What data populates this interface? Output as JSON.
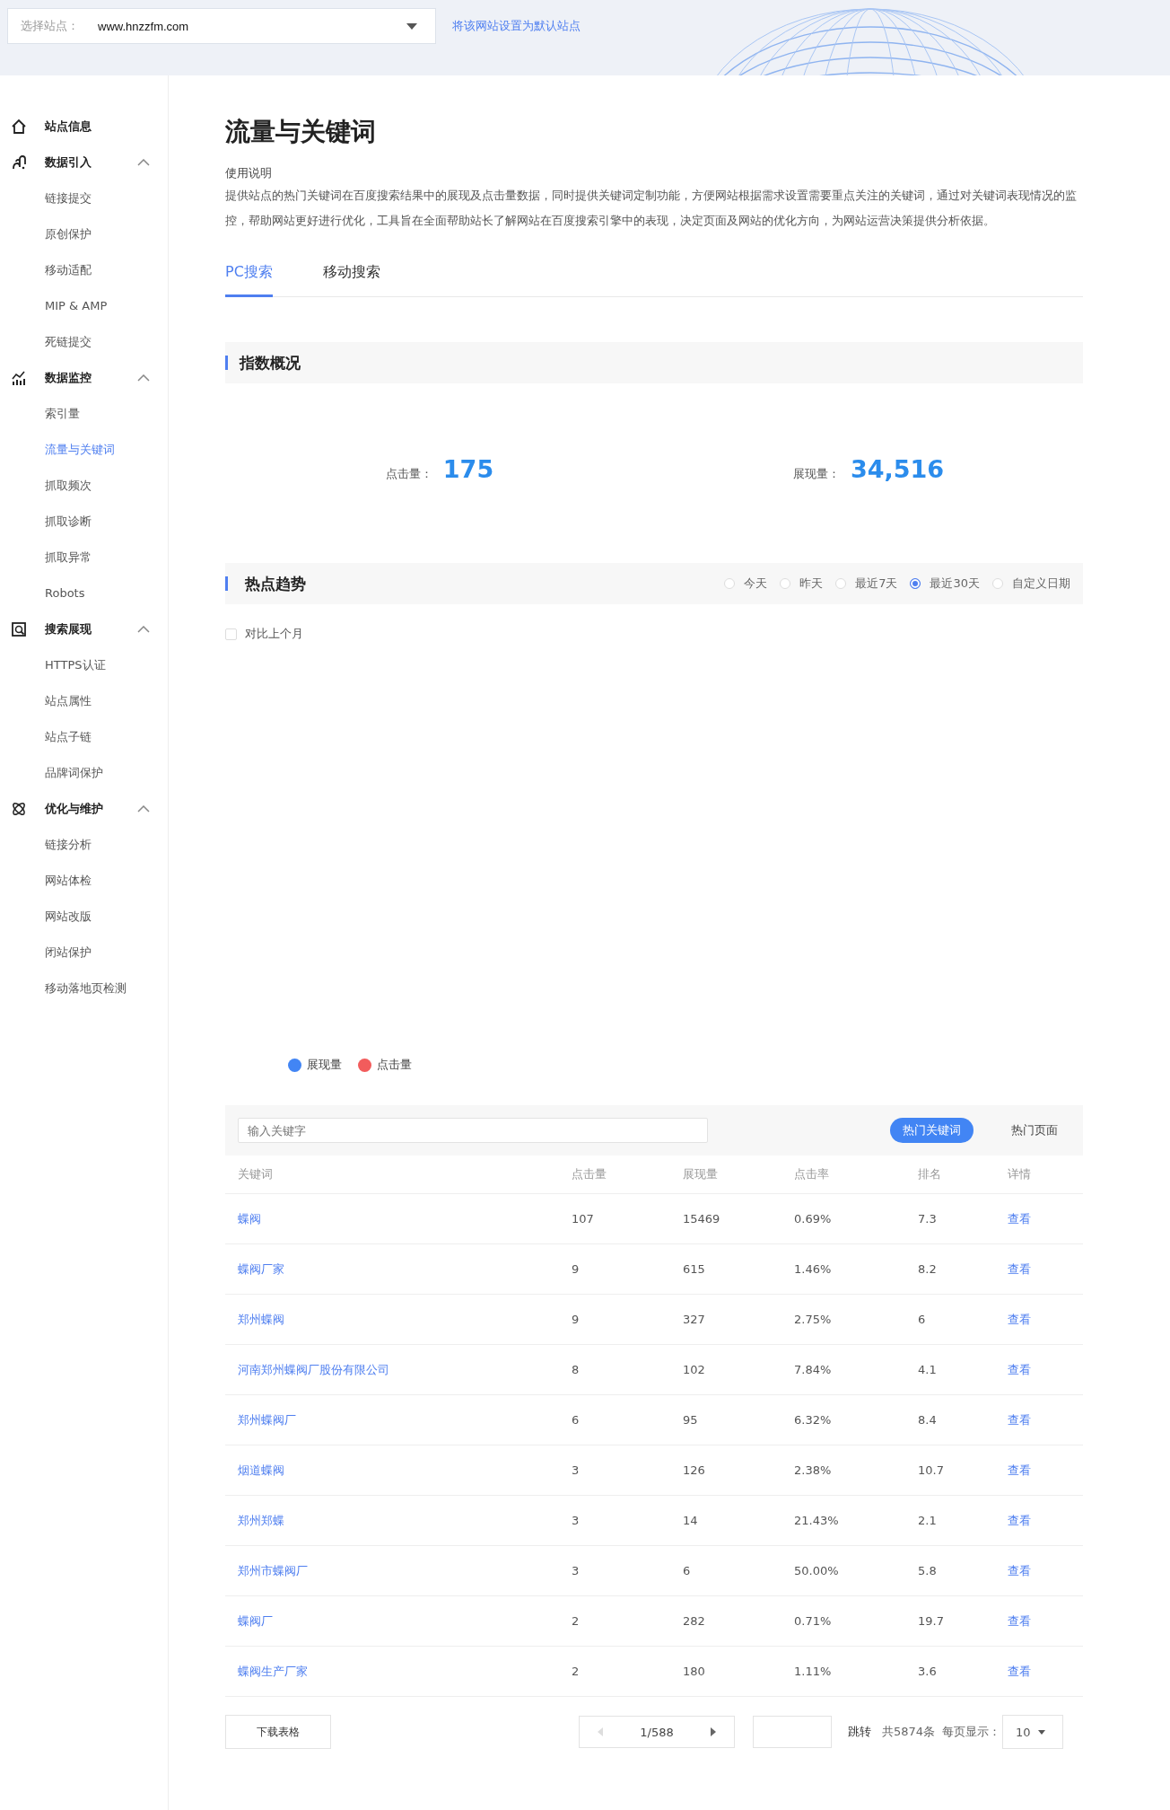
{
  "site_selector": {
    "label": "选择站点：",
    "value": "www.hnzzfm.com"
  },
  "set_default_link": "将该网站设置为默认站点",
  "sidebar": [
    {
      "kind": "link",
      "label": "站点信息"
    },
    {
      "kind": "group",
      "label": "数据引入",
      "expanded": true,
      "children": [
        {
          "label": "链接提交",
          "selected": false
        },
        {
          "label": "原创保护",
          "selected": false
        },
        {
          "label": "移动适配",
          "selected": false
        },
        {
          "label": "MIP & AMP",
          "selected": false
        },
        {
          "label": "死链提交",
          "selected": false
        }
      ]
    },
    {
      "kind": "group",
      "label": "数据监控",
      "expanded": true,
      "children": [
        {
          "label": "索引量",
          "selected": false
        },
        {
          "label": "流量与关键词",
          "selected": true
        },
        {
          "label": "抓取频次",
          "selected": false
        },
        {
          "label": "抓取诊断",
          "selected": false
        },
        {
          "label": "抓取异常",
          "selected": false
        },
        {
          "label": "Robots",
          "selected": false
        }
      ]
    },
    {
      "kind": "group",
      "label": "搜索展现",
      "expanded": true,
      "children": [
        {
          "label": "HTTPS认证",
          "selected": false
        },
        {
          "label": "站点属性",
          "selected": false
        },
        {
          "label": "站点子链",
          "selected": false
        },
        {
          "label": "品牌词保护",
          "selected": false
        }
      ]
    },
    {
      "kind": "group",
      "label": "优化与维护",
      "expanded": true,
      "children": [
        {
          "label": "链接分析",
          "selected": false
        },
        {
          "label": "网站体检",
          "selected": false
        },
        {
          "label": "网站改版",
          "selected": false
        },
        {
          "label": "闭站保护",
          "selected": false
        },
        {
          "label": "移动落地页检测",
          "selected": false
        }
      ]
    }
  ],
  "page_title": "流量与关键词",
  "usage_heading": "使用说明",
  "description": "提供站点的热门关键词在百度搜索结果中的展现及点击量数据，同时提供关键词定制功能，方便网站根据需求设置需要重点关注的关键词，通过对关键词表现情况的监控，帮助网站更好进行优化，工具旨在全面帮助站长了解网站在百度搜索引擎中的表现，决定页面及网站的优化方向，为网站运营决策提供分析依据。",
  "tabs": [
    {
      "label": "PC搜索",
      "selected": true
    },
    {
      "label": "移动搜索",
      "selected": false
    }
  ],
  "overview": {
    "title": "指数概况",
    "stats": [
      {
        "label": "点击量：",
        "value": "175"
      },
      {
        "label": "展现量：",
        "value": "34,516"
      }
    ]
  },
  "trend": {
    "title": "热点趋势",
    "ranges": [
      {
        "label": "今天",
        "selected": false
      },
      {
        "label": "昨天",
        "selected": false
      },
      {
        "label": "最近7天",
        "selected": false
      },
      {
        "label": "最近30天",
        "selected": true
      },
      {
        "label": "自定义日期",
        "selected": false
      }
    ],
    "compare": {
      "label": "对比上个月",
      "checked": false
    },
    "legend": [
      {
        "label": "展现量",
        "color": "#4285f4"
      },
      {
        "label": "点击量",
        "color": "#f25c5c"
      }
    ]
  },
  "keyword_table": {
    "search": {
      "placeholder": "输入关键字"
    },
    "views": [
      {
        "label": "热门关键词",
        "selected": true
      },
      {
        "label": "热门页面",
        "selected": false
      }
    ],
    "columns": [
      "关键词",
      "点击量",
      "展现量",
      "点击率",
      "排名",
      "详情"
    ],
    "rows": [
      [
        "蝶阀",
        "107",
        "15469",
        "0.69%",
        "7.3",
        "查看"
      ],
      [
        "蝶阀厂家",
        "9",
        "615",
        "1.46%",
        "8.2",
        "查看"
      ],
      [
        "郑州蝶阀",
        "9",
        "327",
        "2.75%",
        "6",
        "查看"
      ],
      [
        "河南郑州蝶阀厂股份有限公司",
        "8",
        "102",
        "7.84%",
        "4.1",
        "查看"
      ],
      [
        "郑州蝶阀厂",
        "6",
        "95",
        "6.32%",
        "8.4",
        "查看"
      ],
      [
        "烟道蝶阀",
        "3",
        "126",
        "2.38%",
        "10.7",
        "查看"
      ],
      [
        "郑州郑蝶",
        "3",
        "14",
        "21.43%",
        "2.1",
        "查看"
      ],
      [
        "郑州市蝶阀厂",
        "3",
        "6",
        "50.00%",
        "5.8",
        "查看"
      ],
      [
        "蝶阀厂",
        "2",
        "282",
        "0.71%",
        "19.7",
        "查看"
      ],
      [
        "蝶阀生产厂家",
        "2",
        "180",
        "1.11%",
        "3.6",
        "查看"
      ]
    ]
  },
  "footer": {
    "download": "下载表格",
    "page": "1/588",
    "jump": "跳转",
    "total": "共5874条",
    "per_page_label": "每页显示：",
    "per_page": "10"
  }
}
